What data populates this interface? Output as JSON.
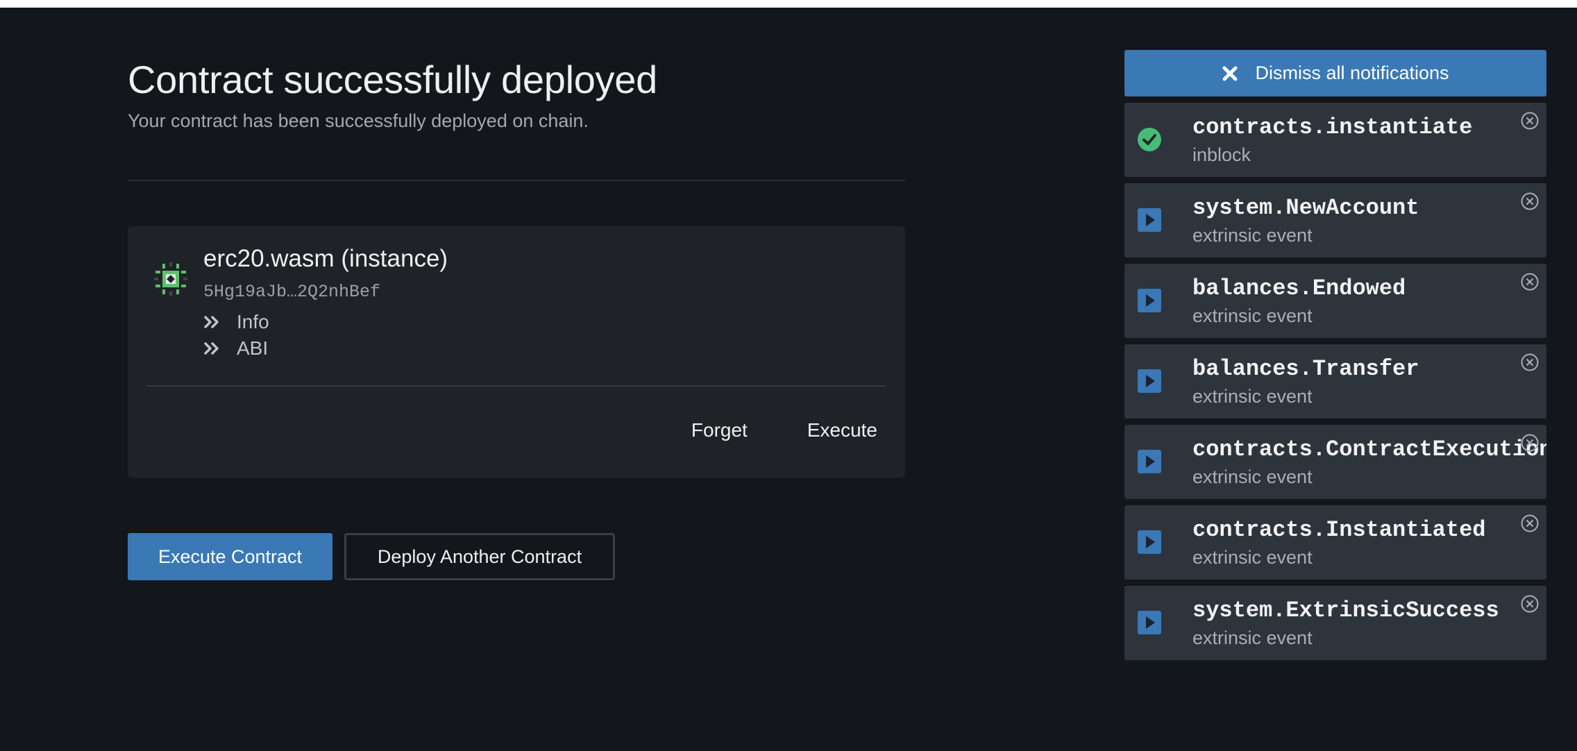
{
  "colors": {
    "background": "#13161b",
    "card": "#1f2328",
    "notification_bg": "#2e343c",
    "accent_blue": "#3a78b6",
    "success_green": "#48bb78",
    "identicon_green": "#5fbf6a"
  },
  "page": {
    "title": "Contract successfully deployed",
    "subtitle": "Your contract has been successfully deployed on chain."
  },
  "contract": {
    "name": "erc20.wasm (instance)",
    "address": "5Hg19aJb…2Q2nhBef",
    "links": [
      {
        "label": "Info",
        "icon": "double-chevron-right-icon"
      },
      {
        "label": "ABI",
        "icon": "double-chevron-right-icon"
      }
    ],
    "actions": {
      "forget": "Forget",
      "execute": "Execute"
    }
  },
  "buttons": {
    "execute_contract": "Execute Contract",
    "deploy_another": "Deploy Another Contract"
  },
  "notifications": {
    "dismiss_all": "Dismiss all notifications",
    "items": [
      {
        "title": "contracts.instantiate",
        "status": "inblock",
        "icon": "check-circle-icon"
      },
      {
        "title": "system.NewAccount",
        "status": "extrinsic event",
        "icon": "play-square-icon"
      },
      {
        "title": "balances.Endowed",
        "status": "extrinsic event",
        "icon": "play-square-icon"
      },
      {
        "title": "balances.Transfer",
        "status": "extrinsic event",
        "icon": "play-square-icon"
      },
      {
        "title": "contracts.ContractExecution",
        "status": "extrinsic event",
        "icon": "play-square-icon"
      },
      {
        "title": "contracts.Instantiated",
        "status": "extrinsic event",
        "icon": "play-square-icon"
      },
      {
        "title": "system.ExtrinsicSuccess",
        "status": "extrinsic event",
        "icon": "play-square-icon"
      }
    ]
  }
}
